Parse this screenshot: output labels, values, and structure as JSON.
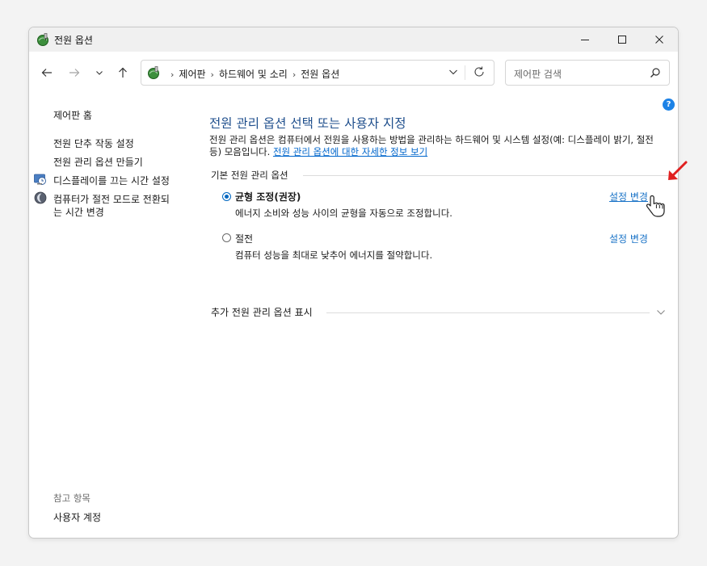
{
  "window": {
    "title": "전원 옵션"
  },
  "address": {
    "crumbs": [
      "제어판",
      "하드웨어 및 소리",
      "전원 옵션"
    ],
    "separator": "›"
  },
  "search": {
    "placeholder": "제어판 검색"
  },
  "sidebar": {
    "home": "제어판 홈",
    "items": [
      {
        "label": "전원 단추 작동 설정",
        "icon": "none"
      },
      {
        "label": "전원 관리 옵션 만들기",
        "icon": "none"
      },
      {
        "label": "디스플레이를 끄는 시간 설정",
        "icon": "display-clock-icon"
      },
      {
        "label": "컴퓨터가 절전 모드로 전환되는 시간 변경",
        "line1": "컴퓨터가 절전 모드로 전환되",
        "line2": "는 시간 변경",
        "icon": "moon-icon"
      }
    ],
    "see_also_heading": "참고 항목",
    "see_also": [
      "사용자 계정"
    ]
  },
  "main": {
    "heading": "전원 관리 옵션 선택 또는 사용자 지정",
    "description": "전원 관리 옵션은 컴퓨터에서 전원을 사용하는 방법을 관리하는 하드웨어 및 시스템 설정(예: 디스플레이 밝기, 절전 등) 모음입니다.",
    "description_link": "전원 관리 옵션에 대한 자세한 정보 보기",
    "plans_heading": "기본 전원 관리 옵션",
    "plans": [
      {
        "name": "균형 조정(권장)",
        "description": "에너지 소비와 성능 사이의 균형을 자동으로 조정합니다.",
        "link": "설정 변경",
        "selected": true
      },
      {
        "name": "절전",
        "description": "컴퓨터 성능을 최대로 낮추어 에너지를 절약합니다.",
        "link": "설정 변경",
        "selected": false
      }
    ],
    "more_plans": "추가 전원 관리 옵션 표시",
    "help_glyph": "?"
  },
  "colors": {
    "accent": "#0067c0",
    "link": "#1a73c7",
    "heading": "#1e4e8c",
    "annotation_arrow": "#e02020"
  }
}
